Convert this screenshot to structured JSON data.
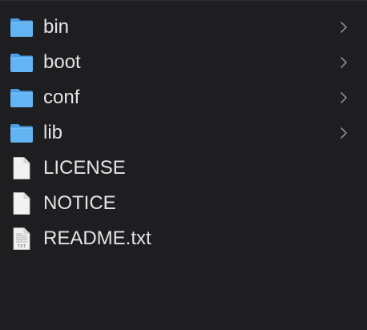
{
  "file_browser": {
    "items": [
      {
        "name": "bin",
        "kind": "folder",
        "icon": "folder-icon",
        "has_children": true
      },
      {
        "name": "boot",
        "kind": "folder",
        "icon": "folder-icon",
        "has_children": true
      },
      {
        "name": "conf",
        "kind": "folder",
        "icon": "folder-icon",
        "has_children": true
      },
      {
        "name": "lib",
        "kind": "folder",
        "icon": "folder-icon",
        "has_children": true
      },
      {
        "name": "LICENSE",
        "kind": "file",
        "icon": "document-icon",
        "has_children": false
      },
      {
        "name": "NOTICE",
        "kind": "file",
        "icon": "document-icon",
        "has_children": false
      },
      {
        "name": "README.txt",
        "kind": "file",
        "icon": "text-file-icon",
        "badge": "TXT",
        "has_children": false
      }
    ]
  },
  "colors": {
    "background": "#1e1e20",
    "text": "#e4e4e6",
    "folder_body": "#63b4f2",
    "folder_tab": "#4a9ee8",
    "document": "#f2f2f2",
    "chevron": "#8a8a8e"
  }
}
